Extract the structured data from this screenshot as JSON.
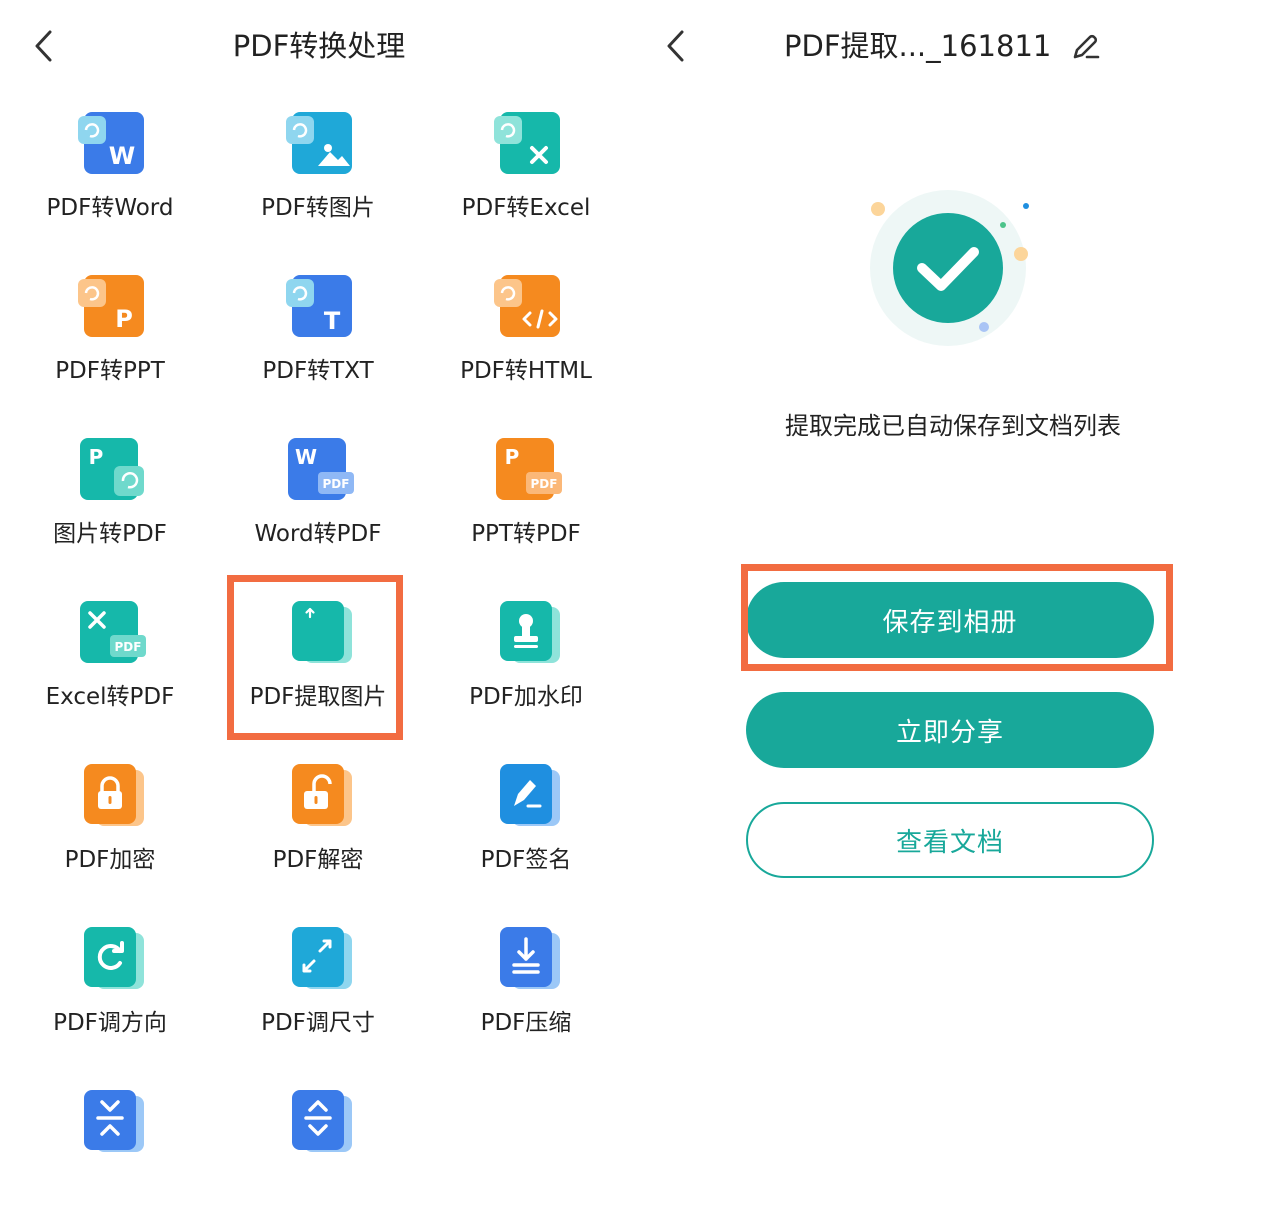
{
  "left": {
    "title": "PDF转换处理",
    "tools": [
      {
        "label": "PDF转Word"
      },
      {
        "label": "PDF转图片"
      },
      {
        "label": "PDF转Excel"
      },
      {
        "label": "PDF转PPT"
      },
      {
        "label": "PDF转TXT"
      },
      {
        "label": "PDF转HTML"
      },
      {
        "label": "图片转PDF"
      },
      {
        "label": "Word转PDF"
      },
      {
        "label": "PPT转PDF"
      },
      {
        "label": "Excel转PDF"
      },
      {
        "label": "PDF提取图片",
        "highlighted": true
      },
      {
        "label": "PDF加水印"
      },
      {
        "label": "PDF加密"
      },
      {
        "label": "PDF解密"
      },
      {
        "label": "PDF签名"
      },
      {
        "label": "PDF调方向"
      },
      {
        "label": "PDF调尺寸"
      },
      {
        "label": "PDF压缩"
      },
      {
        "label": ""
      },
      {
        "label": ""
      }
    ]
  },
  "right": {
    "title": "PDF提取..._161811",
    "message": "提取完成已自动保存到文档列表",
    "buttons": {
      "save_album": "保存到相册",
      "share": "立即分享",
      "view_doc": "查看文档"
    }
  },
  "icon_glyphs": {
    "word": "W",
    "ppt": "P",
    "txt": "T",
    "pdf": "PDF"
  },
  "colors": {
    "accent": "#18a89a",
    "highlight": "#f26c41",
    "blue": "#3b7be8",
    "teal": "#16b8aa",
    "orange": "#f58a1f"
  }
}
